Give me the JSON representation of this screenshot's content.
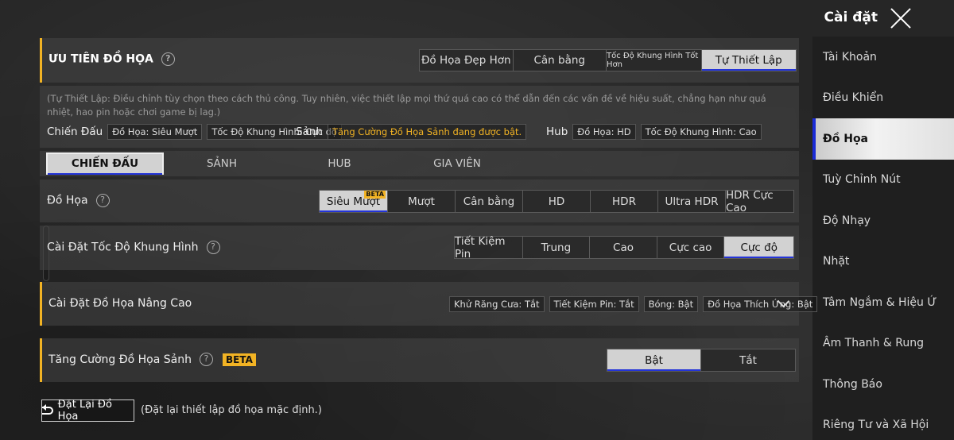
{
  "header": {
    "title": "Cài đặt"
  },
  "sidebar": {
    "items": [
      {
        "label": "Tài Khoản"
      },
      {
        "label": "Điều Khiển"
      },
      {
        "label": "Đồ Họa"
      },
      {
        "label": "Tuỳ Chỉnh Nút"
      },
      {
        "label": "Độ Nhạy"
      },
      {
        "label": "Nhặt"
      },
      {
        "label": "Tâm Ngắm & Hiệu Ứ"
      },
      {
        "label": "Âm Thanh & Rung"
      },
      {
        "label": "Thông Báo"
      },
      {
        "label": "Riêng Tư và Xã Hội"
      }
    ],
    "active_index": 2
  },
  "priority": {
    "title": "ƯU TIÊN ĐỒ HỌA",
    "options": [
      "Đồ Họa Đẹp Hơn",
      "Cân bằng",
      "Tốc Độ Khung Hình Tốt Hơn",
      "Tự Thiết Lập"
    ],
    "selected": "Tự Thiết Lập"
  },
  "info": {
    "text": "(Tự Thiết Lập: Điều chỉnh tùy chọn theo cách thủ công. Tuy nhiên, việc thiết lập mọi thứ quá cao có thể dẫn đến các vấn đề về hiệu suất, chẳng hạn như quá nhiệt, hao pin hoặc chơi game bị lag.)",
    "battle_label": "Chiến Đấu",
    "battle_graphics": "Đồ Họa: Siêu Mượt",
    "battle_fps": "Tốc Độ Khung Hình: Cực độ",
    "lobby_label": "Sảnh",
    "lobby_status": "Tăng Cường Đồ Họa Sảnh đang được bật.",
    "hub_label": "Hub",
    "hub_graphics": "Đồ Họa: HD",
    "hub_fps": "Tốc Độ Khung Hình: Cao"
  },
  "tabs": [
    "CHIẾN ĐẤU",
    "SẢNH",
    "HUB",
    "GIA VIÊN"
  ],
  "graphics": {
    "label": "Đồ Họa",
    "options": [
      "Siêu Mượt",
      "Mượt",
      "Cân bằng",
      "HD",
      "HDR",
      "Ultra HDR",
      "HDR Cực Cao"
    ],
    "selected": "Siêu Mượt",
    "beta_tag": "BETA"
  },
  "fps": {
    "label": "Cài Đặt Tốc Độ Khung Hình",
    "options": [
      "Tiết Kiệm Pin",
      "Trung",
      "Cao",
      "Cực cao",
      "Cực độ"
    ],
    "selected": "Cực độ"
  },
  "advanced": {
    "label": "Cài Đặt Đồ Họa Nâng Cao",
    "chips": [
      "Khử Răng Cưa: Tắt",
      "Tiết Kiệm Pin: Tắt",
      "Bóng: Bật",
      "Đồ Họa Thích Ứng: Bật"
    ]
  },
  "lobby_boost": {
    "label": "Tăng Cường Đồ Họa Sảnh",
    "beta": "BETA",
    "options": [
      "Bật",
      "Tắt"
    ],
    "selected": "Bật"
  },
  "reset": {
    "button": "Đặt Lại Đồ Họa",
    "note": "(Đặt lại thiết lập đồ họa mặc định.)"
  },
  "colors": {
    "accent": "#f2b324",
    "selected_underline": "#2434d8"
  }
}
